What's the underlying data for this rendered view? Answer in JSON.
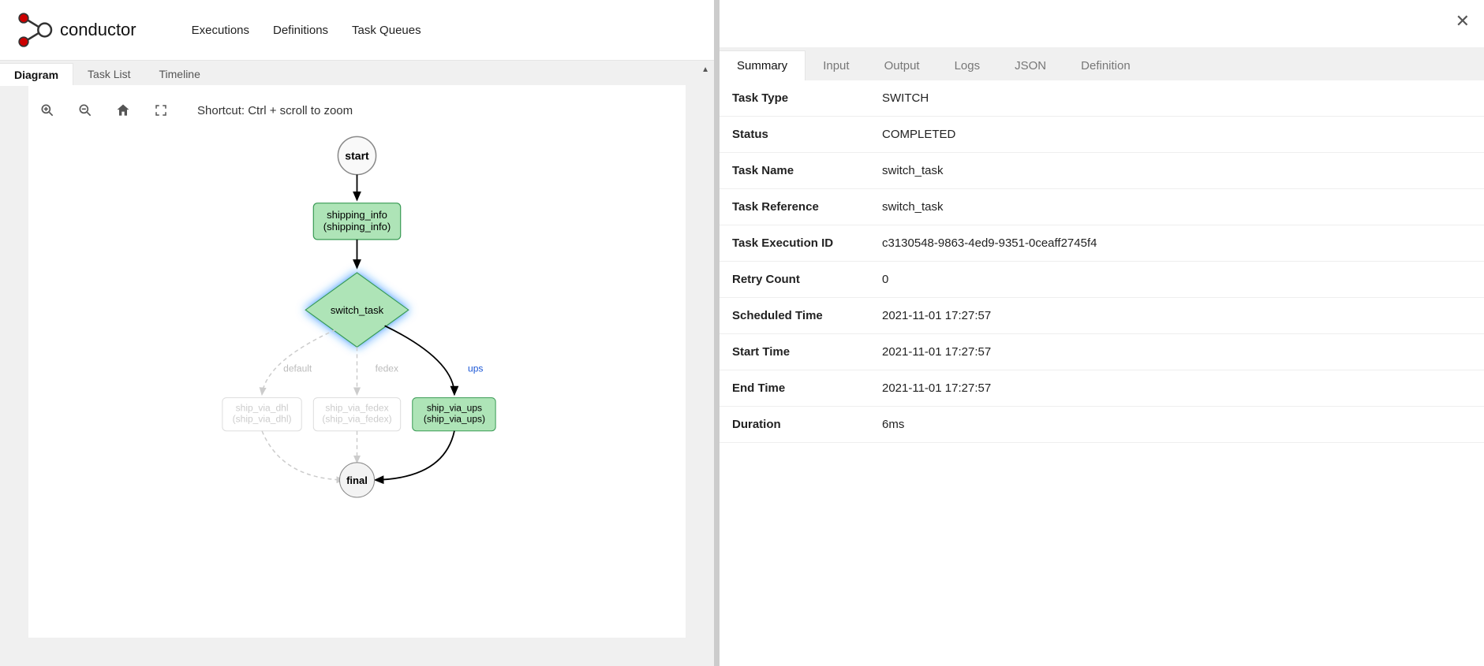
{
  "brand": "conductor",
  "nav": {
    "executions": "Executions",
    "definitions": "Definitions",
    "taskQueues": "Task Queues"
  },
  "subTabs": {
    "diagram": "Diagram",
    "taskList": "Task List",
    "timeline": "Timeline"
  },
  "toolbar": {
    "shortcut": "Shortcut: Ctrl + scroll to zoom"
  },
  "graph": {
    "start": "start",
    "shippingInfo1": "shipping_info",
    "shippingInfo2": "(shipping_info)",
    "switch": "switch_task",
    "branchDefault": "default",
    "branchFedex": "fedex",
    "branchUps": "ups",
    "dhl1": "ship_via_dhl",
    "dhl2": "(ship_via_dhl)",
    "fedex1": "ship_via_fedex",
    "fedex2": "(ship_via_fedex)",
    "ups1": "ship_via_ups",
    "ups2": "(ship_via_ups)",
    "final": "final"
  },
  "detailTabs": {
    "summary": "Summary",
    "input": "Input",
    "output": "Output",
    "logs": "Logs",
    "json": "JSON",
    "definition": "Definition"
  },
  "summary": {
    "k1": "Task Type",
    "v1": "SWITCH",
    "k2": "Status",
    "v2": "COMPLETED",
    "k3": "Task Name",
    "v3": "switch_task",
    "k4": "Task Reference",
    "v4": "switch_task",
    "k5": "Task Execution ID",
    "v5": "c3130548-9863-4ed9-9351-0ceaff2745f4",
    "k6": "Retry Count",
    "v6": "0",
    "k7": "Scheduled Time",
    "v7": "2021-11-01 17:27:57",
    "k8": "Start Time",
    "v8": "2021-11-01 17:27:57",
    "k9": "End Time",
    "v9": "2021-11-01 17:27:57",
    "k10": "Duration",
    "v10": "6ms"
  }
}
